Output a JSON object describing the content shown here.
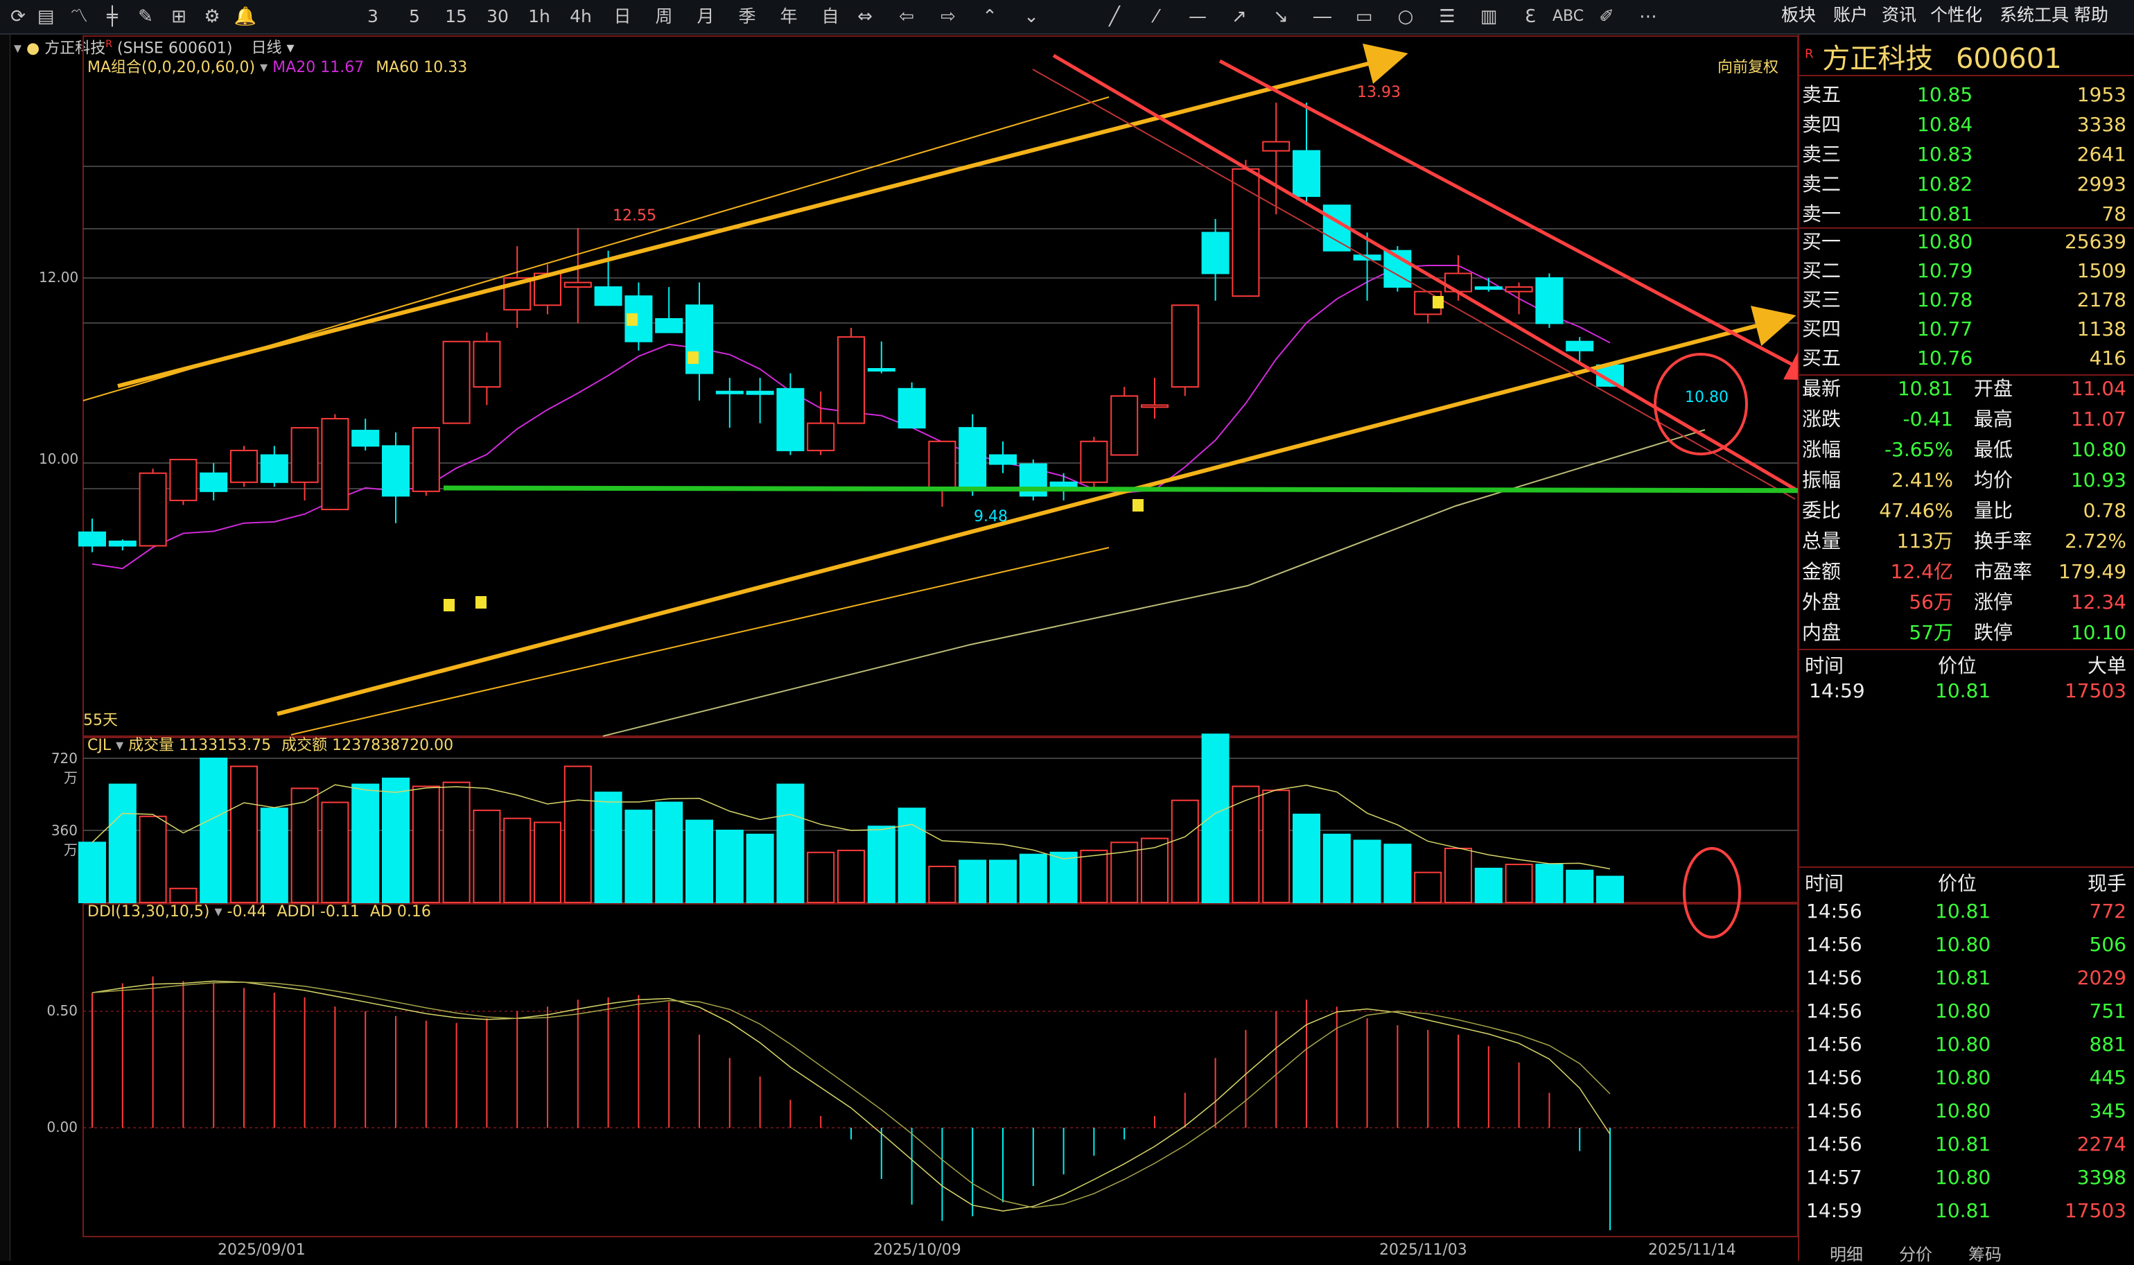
{
  "toolbar": {
    "icons": [
      "refresh-icon",
      "list-icon",
      "line-chart-icon",
      "candle-icon",
      "pattern-icon",
      "grid-icon",
      "sync-icon",
      "alarm-icon"
    ],
    "periods": [
      "3",
      "5",
      "15",
      "30",
      "1h",
      "4h",
      "日",
      "周",
      "月",
      "季",
      "年",
      "自"
    ],
    "tools_text": [
      "ABC"
    ],
    "menu": [
      "板块",
      "账户",
      "资讯",
      "个性化",
      "系统工具",
      "帮助"
    ]
  },
  "info": {
    "stock_label": "方正科技",
    "superscript": "R",
    "code_text": "(SHSE 600601)",
    "period": "日线"
  },
  "main": {
    "ma_label": "MA组合(0,0,20,0,60,0)",
    "ma20_label": "MA20",
    "ma20_value": "11.67",
    "ma60_label": "MA60",
    "ma60_value": "10.33",
    "adjust_label": "向前复权",
    "high_label": "13.93",
    "mid_high_label": "12.55",
    "low_label": "9.48",
    "last_label": "10.80",
    "days_label": "55天",
    "y_ticks": [
      "12.00",
      "10.00"
    ],
    "colors": {
      "up": "#ff3b3b",
      "down": "#00f0f0",
      "ma20": "#d02adb",
      "ma60": "#bdbd7a",
      "trend_yellow": "#f5b31a",
      "trend_red": "#ff4040",
      "support_green": "#22c322"
    }
  },
  "volume": {
    "label": "CJL",
    "vol_label": "成交量",
    "vol_value": "1133153.75",
    "amt_label": "成交额",
    "amt_value": "1237838720.00",
    "y_ticks": [
      "720万",
      "360万"
    ]
  },
  "ddi": {
    "label": "DDI(13,30,10,5)",
    "ddi_value": "-0.44",
    "addi_label": "ADDI",
    "addi_value": "-0.11",
    "ad_label": "AD",
    "ad_value": "0.16",
    "y_ticks": [
      "0.50",
      "0.00"
    ]
  },
  "x_axis": [
    "2025/09/01",
    "2025/10/09",
    "2025/11/03",
    "2025/11/14"
  ],
  "chart_data": {
    "type": "candlestick",
    "dates_shown": [
      "2025/09/01",
      "2025/10/09",
      "2025/11/03",
      "2025/11/14"
    ],
    "ylim": [
      8.0,
      14.3
    ],
    "candles": [
      {
        "o": 9.05,
        "h": 9.35,
        "l": 8.98,
        "c": 9.2,
        "d": true
      },
      {
        "o": 9.05,
        "h": 9.12,
        "l": 9.0,
        "c": 9.1,
        "d": true
      },
      {
        "o": 9.05,
        "h": 9.9,
        "l": 9.05,
        "c": 9.85,
        "d": false
      },
      {
        "o": 9.55,
        "h": 10.0,
        "l": 9.5,
        "c": 10.0,
        "d": false
      },
      {
        "o": 9.85,
        "h": 9.96,
        "l": 9.55,
        "c": 9.65,
        "d": true
      },
      {
        "o": 9.75,
        "h": 10.15,
        "l": 9.7,
        "c": 10.1,
        "d": false
      },
      {
        "o": 10.05,
        "h": 10.15,
        "l": 9.7,
        "c": 9.75,
        "d": true
      },
      {
        "o": 9.75,
        "h": 10.35,
        "l": 9.55,
        "c": 10.35,
        "d": false
      },
      {
        "o": 9.45,
        "h": 10.5,
        "l": 9.45,
        "c": 10.45,
        "d": false
      },
      {
        "o": 10.32,
        "h": 10.45,
        "l": 10.1,
        "c": 10.15,
        "d": true
      },
      {
        "o": 10.15,
        "h": 10.3,
        "l": 9.3,
        "c": 9.6,
        "d": true
      },
      {
        "o": 9.65,
        "h": 10.35,
        "l": 9.6,
        "c": 10.35,
        "d": false
      },
      {
        "o": 10.4,
        "h": 11.3,
        "l": 10.4,
        "c": 11.3,
        "d": false
      },
      {
        "o": 10.8,
        "h": 11.4,
        "l": 10.6,
        "c": 11.3,
        "d": false
      },
      {
        "o": 11.65,
        "h": 12.35,
        "l": 11.45,
        "c": 12.0,
        "d": false
      },
      {
        "o": 11.7,
        "h": 12.15,
        "l": 11.6,
        "c": 12.05,
        "d": false
      },
      {
        "o": 11.95,
        "h": 12.55,
        "l": 11.5,
        "c": 11.9,
        "d": false
      },
      {
        "o": 11.9,
        "h": 12.3,
        "l": 11.75,
        "c": 11.7,
        "d": true
      },
      {
        "o": 11.8,
        "h": 11.95,
        "l": 11.2,
        "c": 11.3,
        "d": true
      },
      {
        "o": 11.55,
        "h": 11.9,
        "l": 11.4,
        "c": 11.4,
        "d": true
      },
      {
        "o": 11.7,
        "h": 11.95,
        "l": 10.65,
        "c": 10.95,
        "d": true
      },
      {
        "o": 10.75,
        "h": 10.9,
        "l": 10.35,
        "c": 10.75,
        "d": true
      },
      {
        "o": 10.75,
        "h": 10.9,
        "l": 10.4,
        "c": 10.72,
        "d": true
      },
      {
        "o": 10.78,
        "h": 10.95,
        "l": 10.05,
        "c": 10.1,
        "d": true
      },
      {
        "o": 10.1,
        "h": 10.75,
        "l": 10.05,
        "c": 10.4,
        "d": false
      },
      {
        "o": 10.4,
        "h": 11.45,
        "l": 10.4,
        "c": 11.35,
        "d": false
      },
      {
        "o": 11.0,
        "h": 11.3,
        "l": 10.95,
        "c": 11.0,
        "d": true
      },
      {
        "o": 10.78,
        "h": 10.85,
        "l": 10.35,
        "c": 10.35,
        "d": true
      },
      {
        "o": 10.2,
        "h": 10.2,
        "l": 9.48,
        "c": 9.68,
        "d": false
      },
      {
        "o": 10.35,
        "h": 10.5,
        "l": 9.6,
        "c": 9.7,
        "d": true
      },
      {
        "o": 10.05,
        "h": 10.2,
        "l": 9.85,
        "c": 9.95,
        "d": true
      },
      {
        "o": 9.95,
        "h": 10.0,
        "l": 9.55,
        "c": 9.6,
        "d": true
      },
      {
        "o": 9.75,
        "h": 9.85,
        "l": 9.55,
        "c": 9.7,
        "d": true
      },
      {
        "o": 9.75,
        "h": 10.25,
        "l": 9.65,
        "c": 10.2,
        "d": false
      },
      {
        "o": 10.05,
        "h": 10.8,
        "l": 10.05,
        "c": 10.7,
        "d": false
      },
      {
        "o": 10.6,
        "h": 10.9,
        "l": 10.45,
        "c": 10.6,
        "d": false
      },
      {
        "o": 10.8,
        "h": 11.7,
        "l": 10.7,
        "c": 11.7,
        "d": false
      },
      {
        "o": 12.5,
        "h": 12.65,
        "l": 11.75,
        "c": 12.05,
        "d": true
      },
      {
        "o": 11.8,
        "h": 13.3,
        "l": 11.8,
        "c": 13.2,
        "d": false
      },
      {
        "o": 13.4,
        "h": 13.93,
        "l": 12.7,
        "c": 13.5,
        "d": false
      },
      {
        "o": 13.4,
        "h": 13.93,
        "l": 12.8,
        "c": 12.9,
        "d": true
      },
      {
        "o": 12.8,
        "h": 12.8,
        "l": 12.3,
        "c": 12.3,
        "d": true
      },
      {
        "o": 12.25,
        "h": 12.5,
        "l": 11.75,
        "c": 12.2,
        "d": true
      },
      {
        "o": 12.3,
        "h": 12.35,
        "l": 11.85,
        "c": 11.9,
        "d": true
      },
      {
        "o": 11.6,
        "h": 11.85,
        "l": 11.5,
        "c": 11.85,
        "d": false
      },
      {
        "o": 11.85,
        "h": 12.25,
        "l": 11.75,
        "c": 12.05,
        "d": false
      },
      {
        "o": 11.9,
        "h": 12.0,
        "l": 11.85,
        "c": 11.88,
        "d": true
      },
      {
        "o": 11.85,
        "h": 11.95,
        "l": 11.6,
        "c": 11.9,
        "d": false
      },
      {
        "o": 12.0,
        "h": 12.05,
        "l": 11.45,
        "c": 11.5,
        "d": true
      },
      {
        "o": 11.3,
        "h": 11.35,
        "l": 11.05,
        "c": 11.2,
        "d": true
      },
      {
        "o": 11.04,
        "h": 11.07,
        "l": 10.8,
        "c": 10.81,
        "d": true
      }
    ],
    "volumes_wan": [
      300,
      590,
      430,
      70,
      720,
      680,
      470,
      570,
      500,
      590,
      620,
      580,
      600,
      460,
      420,
      400,
      680,
      550,
      460,
      500,
      410,
      360,
      340,
      590,
      250,
      260,
      380,
      470,
      180,
      210,
      210,
      240,
      250,
      260,
      300,
      320,
      510,
      840,
      580,
      560,
      440,
      340,
      310,
      290,
      150,
      270,
      170,
      190,
      190,
      160,
      130
    ]
  },
  "orderbook": {
    "title": "方正科技",
    "code": "600601",
    "asks": [
      {
        "label": "卖五",
        "price": "10.85",
        "qty": "1953"
      },
      {
        "label": "卖四",
        "price": "10.84",
        "qty": "3338"
      },
      {
        "label": "卖三",
        "price": "10.83",
        "qty": "2641"
      },
      {
        "label": "卖二",
        "price": "10.82",
        "qty": "2993"
      },
      {
        "label": "卖一",
        "price": "10.81",
        "qty": "78"
      }
    ],
    "bids": [
      {
        "label": "买一",
        "price": "10.80",
        "qty": "25639"
      },
      {
        "label": "买二",
        "price": "10.79",
        "qty": "1509"
      },
      {
        "label": "买三",
        "price": "10.78",
        "qty": "2178"
      },
      {
        "label": "买四",
        "price": "10.77",
        "qty": "1138"
      },
      {
        "label": "买五",
        "price": "10.76",
        "qty": "416"
      }
    ]
  },
  "stats": [
    {
      "l1": "最新",
      "v1": "10.81",
      "c1": "down",
      "l2": "开盘",
      "v2": "11.04",
      "c2": "up"
    },
    {
      "l1": "涨跌",
      "v1": "-0.41",
      "c1": "down",
      "l2": "最高",
      "v2": "11.07",
      "c2": "up"
    },
    {
      "l1": "涨幅",
      "v1": "-3.65%",
      "c1": "down",
      "l2": "最低",
      "v2": "10.80",
      "c2": "down"
    },
    {
      "l1": "振幅",
      "v1": "2.41%",
      "c1": "ylw",
      "l2": "均价",
      "v2": "10.93",
      "c2": "down"
    },
    {
      "l1": "委比",
      "v1": "47.46%",
      "c1": "ylw",
      "l2": "量比",
      "v2": "0.78",
      "c2": "ylw"
    },
    {
      "l1": "总量",
      "v1": "113万",
      "c1": "ylw",
      "l2": "换手率",
      "v2": "2.72%",
      "c2": "ylw"
    },
    {
      "l1": "金额",
      "v1": "12.4亿",
      "c1": "up",
      "l2": "市盈率",
      "v2": "179.49",
      "c2": "ylw"
    },
    {
      "l1": "外盘",
      "v1": "56万",
      "c1": "up",
      "l2": "涨停",
      "v2": "12.34",
      "c2": "up"
    },
    {
      "l1": "内盘",
      "v1": "57万",
      "c1": "down",
      "l2": "跌停",
      "v2": "10.10",
      "c2": "down"
    }
  ],
  "bigtrade": {
    "headers": [
      "时间",
      "价位",
      "大单"
    ],
    "rows": [
      {
        "t": "14:59",
        "p": "10.81",
        "v": "17503"
      }
    ]
  },
  "ticks": {
    "headers": [
      "时间",
      "价位",
      "现手"
    ],
    "rows": [
      {
        "t": "14:56",
        "p": "10.81",
        "v": "772",
        "c": "up"
      },
      {
        "t": "14:56",
        "p": "10.80",
        "v": "506",
        "c": "down"
      },
      {
        "t": "14:56",
        "p": "10.81",
        "v": "2029",
        "c": "up"
      },
      {
        "t": "14:56",
        "p": "10.80",
        "v": "751",
        "c": "down"
      },
      {
        "t": "14:56",
        "p": "10.80",
        "v": "881",
        "c": "down"
      },
      {
        "t": "14:56",
        "p": "10.80",
        "v": "445",
        "c": "down"
      },
      {
        "t": "14:56",
        "p": "10.80",
        "v": "345",
        "c": "down"
      },
      {
        "t": "14:56",
        "p": "10.81",
        "v": "2274",
        "c": "up"
      },
      {
        "t": "14:57",
        "p": "10.80",
        "v": "3398",
        "c": "down"
      },
      {
        "t": "14:59",
        "p": "10.81",
        "v": "17503",
        "c": "up"
      }
    ]
  },
  "bottom_tabs": [
    "明细",
    "分价",
    "筹码"
  ]
}
